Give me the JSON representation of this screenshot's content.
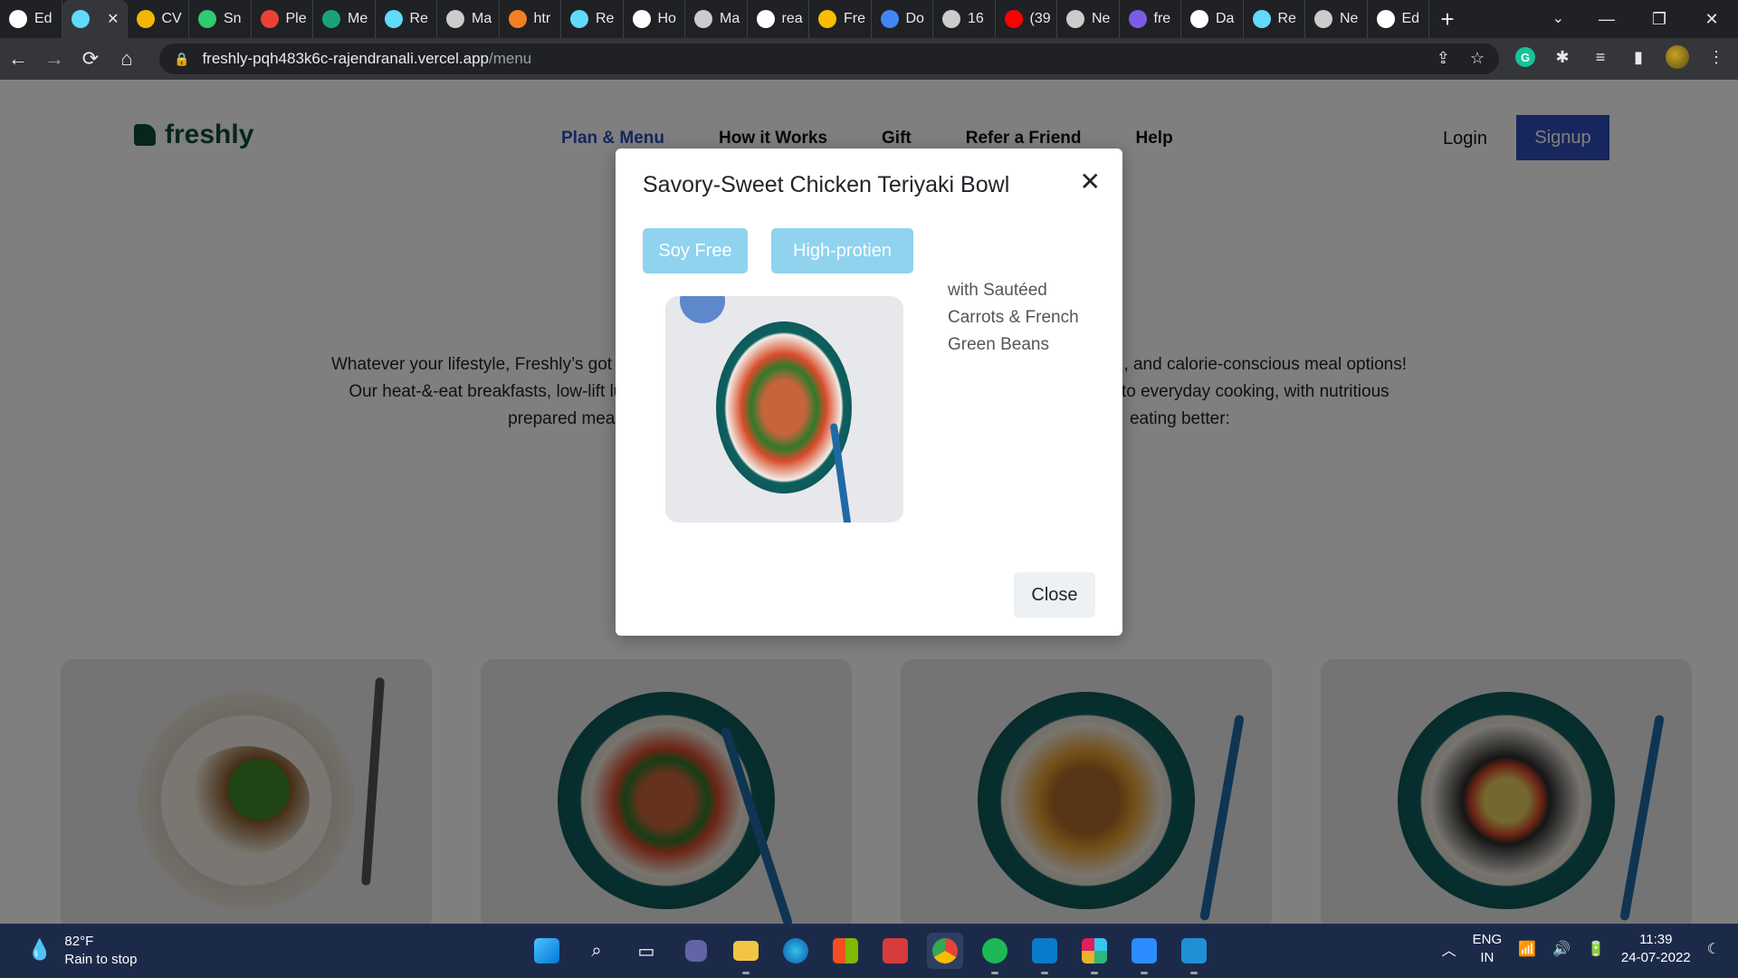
{
  "browser": {
    "tabs": [
      {
        "label": "Ed",
        "icon": "github-icon",
        "color": "#ffffff"
      },
      {
        "label": "",
        "icon": "react-icon",
        "color": "#61dafb",
        "active": true
      },
      {
        "label": "CV",
        "icon": "hourglass-icon",
        "color": "#f2b705"
      },
      {
        "label": "Sn",
        "icon": "snip-icon",
        "color": "#2ecc71"
      },
      {
        "label": "Ple",
        "icon": "gmail-icon",
        "color": "#ea4335"
      },
      {
        "label": "Me",
        "icon": "freshly-icon",
        "color": "#1aa37a"
      },
      {
        "label": "Re",
        "icon": "react-icon",
        "color": "#61dafb"
      },
      {
        "label": "Ma",
        "icon": "vercel-icon",
        "color": "#cccccc"
      },
      {
        "label": "htr",
        "icon": "stack-icon",
        "color": "#f48024"
      },
      {
        "label": "Re",
        "icon": "react-icon",
        "color": "#61dafb"
      },
      {
        "label": "Ho",
        "icon": "meet-icon",
        "color": "#ffffff"
      },
      {
        "label": "Ma",
        "icon": "vercel-icon",
        "color": "#cccccc"
      },
      {
        "label": "rea",
        "icon": "google-icon",
        "color": "#ffffff"
      },
      {
        "label": "Fre",
        "icon": "drive-icon",
        "color": "#fbbc04"
      },
      {
        "label": "Do",
        "icon": "download-icon",
        "color": "#4285f4"
      },
      {
        "label": "16",
        "icon": "vercel-icon",
        "color": "#cccccc"
      },
      {
        "label": "(39",
        "icon": "youtube-icon",
        "color": "#ff0000"
      },
      {
        "label": "Ne",
        "icon": "chrome-icon",
        "color": "#cccccc"
      },
      {
        "label": "fre",
        "icon": "heroku-icon",
        "color": "#7a5ce6"
      },
      {
        "label": "Da",
        "icon": "triangle-icon",
        "color": "#ffffff"
      },
      {
        "label": "Re",
        "icon": "react-icon",
        "color": "#61dafb"
      },
      {
        "label": "Ne",
        "icon": "chrome-icon",
        "color": "#cccccc"
      },
      {
        "label": "Ed",
        "icon": "github-icon",
        "color": "#ffffff"
      }
    ],
    "new_tab": "+",
    "url_host": "freshly-pqh483k6c-rajendranali.vercel.app",
    "url_path": "/menu"
  },
  "site": {
    "logo": "freshly",
    "nav": [
      "Plan & Menu",
      "How it Works",
      "Gift",
      "Refer a Friend",
      "Help"
    ],
    "login": "Login",
    "signup": "Signup",
    "intro_line1_a": "Whatever your lifestyle, Freshly’s got yo",
    "intro_line1_b": ", and calorie-conscious meal options!",
    "intro_line2_a": "Our heat-&-eat breakfasts, low-lift lun",
    "intro_line2_b": "to everyday cooking, with nutritious",
    "intro_line3_a": "prepared meals c",
    "intro_line3_b": "eating better:"
  },
  "modal": {
    "title": "Savory-Sweet Chicken Teriyaki Bowl",
    "tags": [
      "Soy Free",
      "High-protien"
    ],
    "description": "with Sautéed Carrots & French Green Beans",
    "close_label": "Close",
    "tag_color": "#8fd3ef"
  },
  "taskbar": {
    "temperature": "82°F",
    "weather": "Rain to stop",
    "lang_1": "ENG",
    "lang_2": "IN",
    "time": "11:39",
    "date": "24-07-2022"
  }
}
